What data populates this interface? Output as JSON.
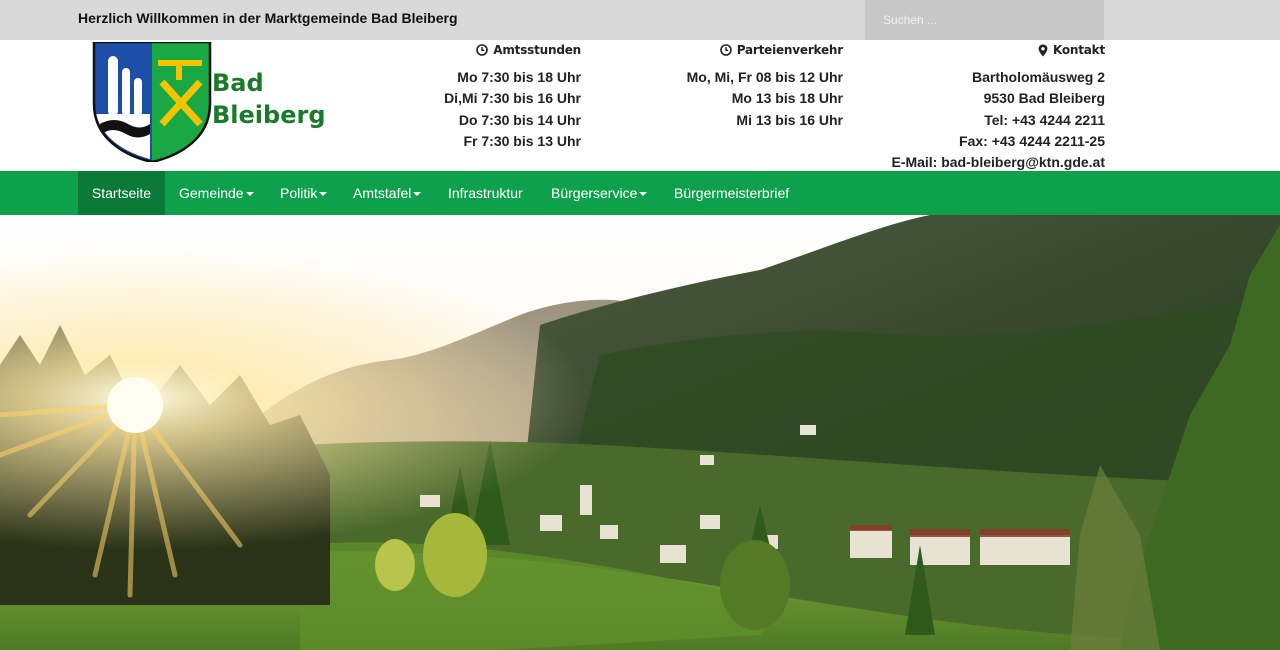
{
  "topbar": {
    "welcome": "Herzlich Willkommen in der Marktgemeinde Bad Bleiberg",
    "search_placeholder": "Suchen ..."
  },
  "brand": {
    "line1": "Bad",
    "line2": "Bleiberg"
  },
  "amtsstunden": {
    "title": "Amtsstunden",
    "lines": [
      "Mo 7:30 bis 18 Uhr",
      "Di,Mi 7:30 bis 16 Uhr",
      "Do 7:30 bis 14 Uhr",
      "Fr 7:30 bis 13 Uhr"
    ]
  },
  "parteienverkehr": {
    "title": "Parteienverkehr",
    "lines": [
      "Mo, Mi, Fr 08 bis 12 Uhr",
      "Mo 13 bis 18 Uhr",
      "Mi 13 bis 16 Uhr"
    ]
  },
  "kontakt": {
    "title": "Kontakt",
    "lines": [
      "Bartholomäusweg 2",
      "9530 Bad Bleiberg",
      "Tel: +43 4244 2211",
      "Fax: +43 4244 2211-25",
      "E-Mail: bad-bleiberg@ktn.gde.at"
    ]
  },
  "nav": {
    "items": [
      {
        "label": "Startseite"
      },
      {
        "label": "Gemeinde"
      },
      {
        "label": "Politik"
      },
      {
        "label": "Amtstafel"
      },
      {
        "label": "Infrastruktur"
      },
      {
        "label": "Bürgerservice"
      },
      {
        "label": "Bürgermeisterbrief"
      }
    ]
  },
  "colors": {
    "nav_green": "#0ea04b",
    "nav_active": "#0b7a38",
    "brand_green": "#1a7a2a",
    "topbar_gray": "#d9d9d9"
  }
}
